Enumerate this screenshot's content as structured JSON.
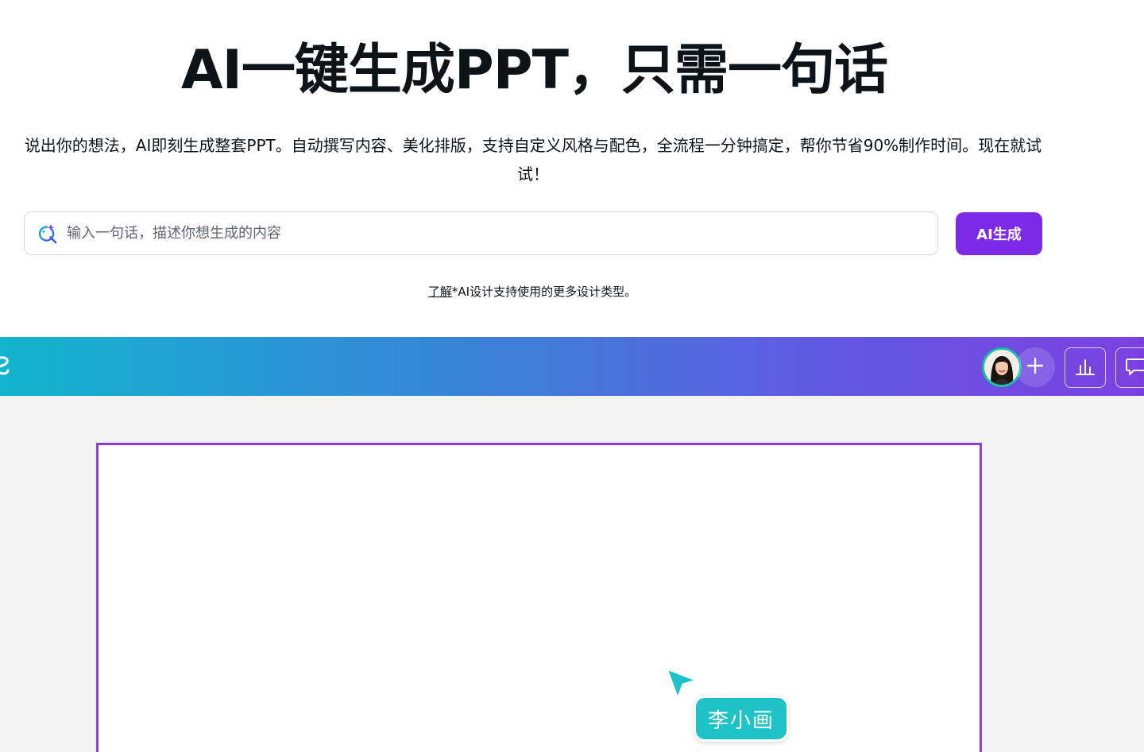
{
  "hero": {
    "title": "AI一键生成PPT，只需一句话",
    "description": "说出你的想法，AI即刻生成整套PPT。自动撰写内容、美化排版，支持自定义风格与配色，全流程一分钟搞定，帮你节省90%制作时间。现在就试试！"
  },
  "search": {
    "placeholder": "输入一句话，描述你想生成的内容",
    "value": "",
    "icon": "ai-sparkle-search-icon"
  },
  "generate_button": {
    "label": "AI生成",
    "color": "#7d2ae8"
  },
  "learn_more": {
    "link_text": "了解",
    "rest_text": "*AI设计支持使用的更多设计类型。"
  },
  "banner": {
    "gradient": [
      "#12b4cf",
      "#3d7fd8",
      "#5f5ce2",
      "#7b3fe0"
    ],
    "icons": [
      "canva-logo-icon",
      "plus-icon",
      "bar-chart-icon",
      "comment-icon"
    ]
  },
  "canvas": {
    "slide_border_color": "#8b3ddf",
    "collaborator_name": "李小画",
    "collaborator_color": "#1fc2c6"
  }
}
